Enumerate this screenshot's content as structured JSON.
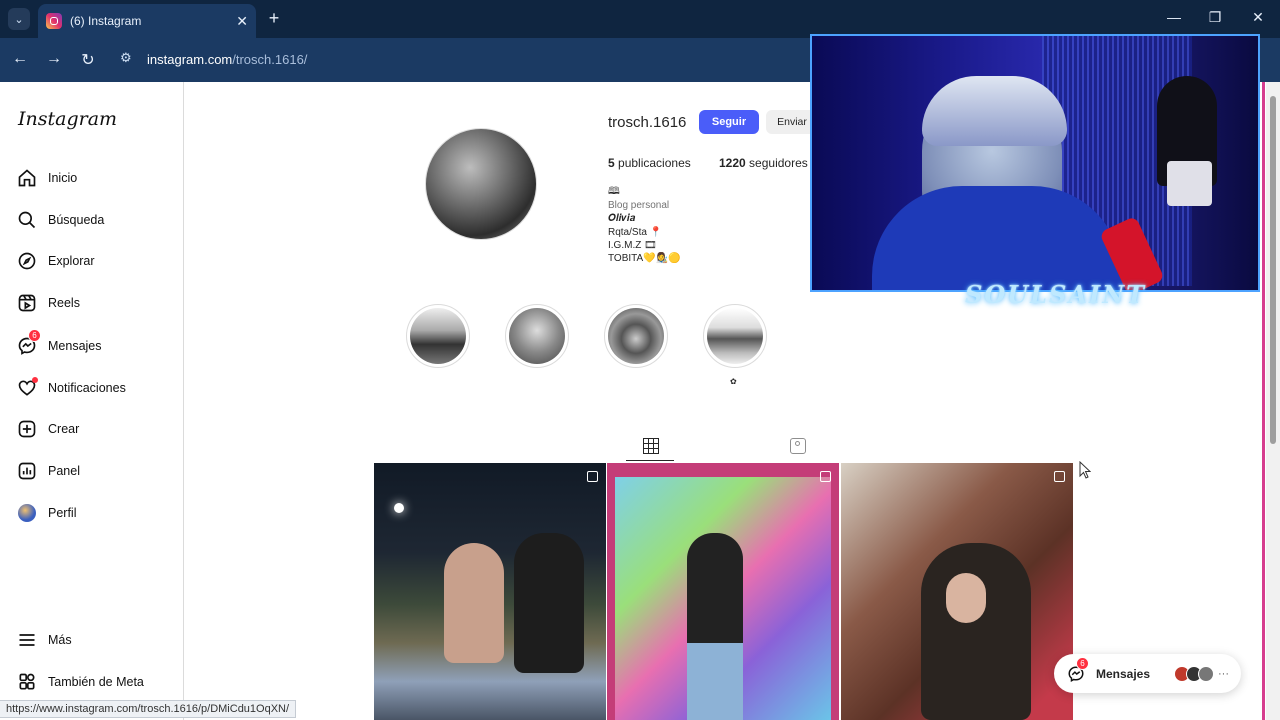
{
  "browser": {
    "tab_title": "(6) Instagram",
    "url_host": "instagram.com",
    "url_path": "/trosch.1616/",
    "status_url": "https://www.instagram.com/trosch.1616/p/DMiCdu1OqXN/"
  },
  "sidebar": {
    "logo": "Instagram",
    "items": [
      {
        "label": "Inicio",
        "icon": "home-icon"
      },
      {
        "label": "Búsqueda",
        "icon": "search-icon"
      },
      {
        "label": "Explorar",
        "icon": "compass-icon"
      },
      {
        "label": "Reels",
        "icon": "reels-icon"
      },
      {
        "label": "Mensajes",
        "icon": "messenger-icon",
        "badge": "6"
      },
      {
        "label": "Notificaciones",
        "icon": "heart-icon"
      },
      {
        "label": "Crear",
        "icon": "plus-icon"
      },
      {
        "label": "Panel",
        "icon": "dashboard-icon"
      },
      {
        "label": "Perfil",
        "icon": "avatar-icon"
      }
    ],
    "more": {
      "label": "Más",
      "icon": "menu-icon"
    },
    "meta": {
      "label": "También de Meta",
      "icon": "meta-icon"
    }
  },
  "profile": {
    "username": "trosch.1616",
    "follow_label": "Seguir",
    "message_label": "Enviar",
    "posts_count": "5",
    "posts_label": "publicaciones",
    "followers_count": "1220",
    "followers_label": "seguidores",
    "bio": {
      "emoji_line": "🕮",
      "category": "Blog personal",
      "line1": "𝑶𝒍𝒊𝒗𝒊𝒂",
      "line2": "Rqta/Sta 📍",
      "line3": "I.G.M.Z 🎞",
      "line4": "TOBITA💛👩‍🎨🟡"
    },
    "highlight_label": "✿"
  },
  "messages_pill": {
    "label": "Mensajes",
    "badge": "6"
  },
  "webcam": {
    "overlay_text": "SOULSAINT"
  },
  "colors": {
    "accent": "#4a5df9",
    "badge": "#ff3040",
    "chrome": "#1b3a63"
  }
}
